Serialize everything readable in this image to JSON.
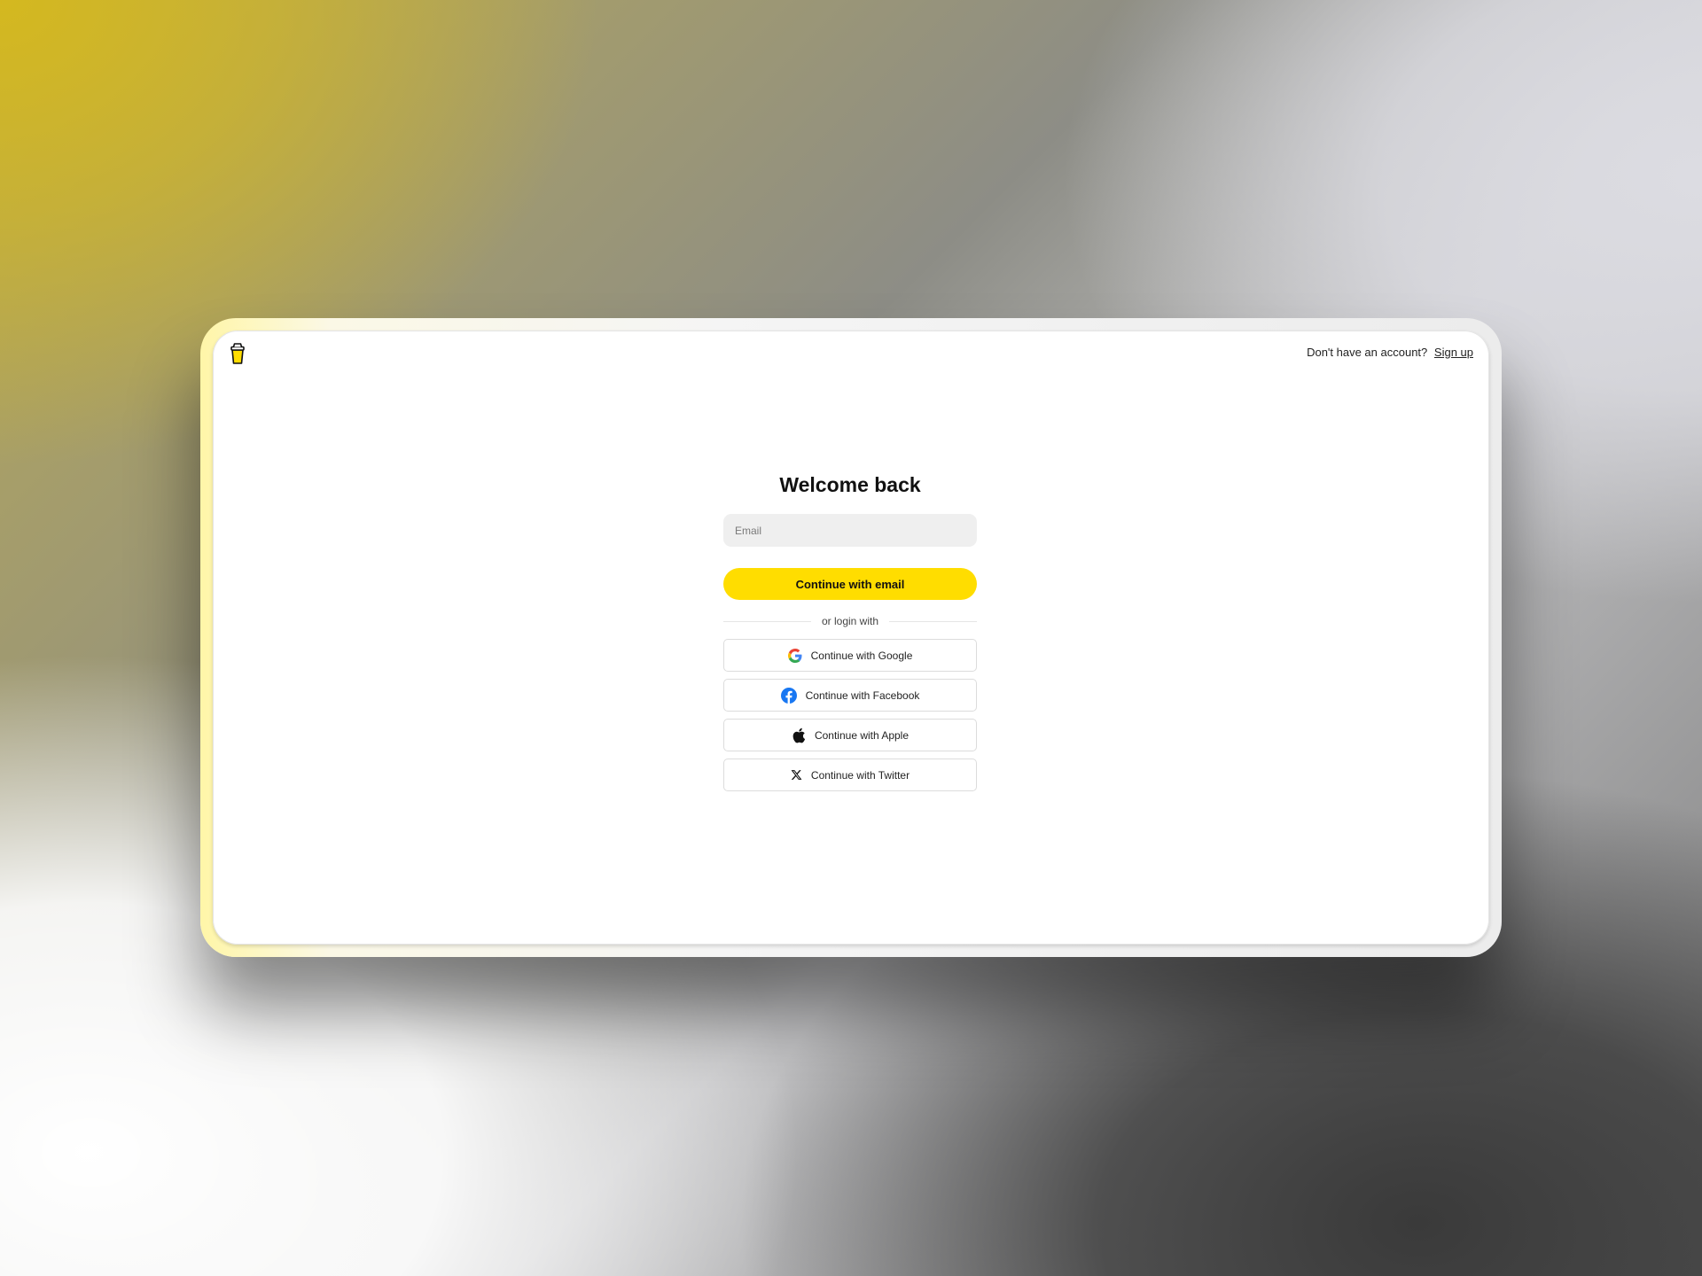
{
  "header": {
    "logo_icon": "coffee-cup-icon",
    "prompt_text": "Don't have an account?",
    "signup_label": "Sign up"
  },
  "login": {
    "title": "Welcome back",
    "email_placeholder": "Email",
    "email_value": "",
    "continue_email_label": "Continue with email",
    "divider_text": "or login with",
    "providers": [
      {
        "label": "Continue with Google",
        "icon": "google-icon"
      },
      {
        "label": "Continue with Facebook",
        "icon": "facebook-icon"
      },
      {
        "label": "Continue with Apple",
        "icon": "apple-icon"
      },
      {
        "label": "Continue with Twitter",
        "icon": "x-icon"
      }
    ]
  },
  "colors": {
    "accent": "#FFDD00",
    "facebook": "#1877F2"
  }
}
